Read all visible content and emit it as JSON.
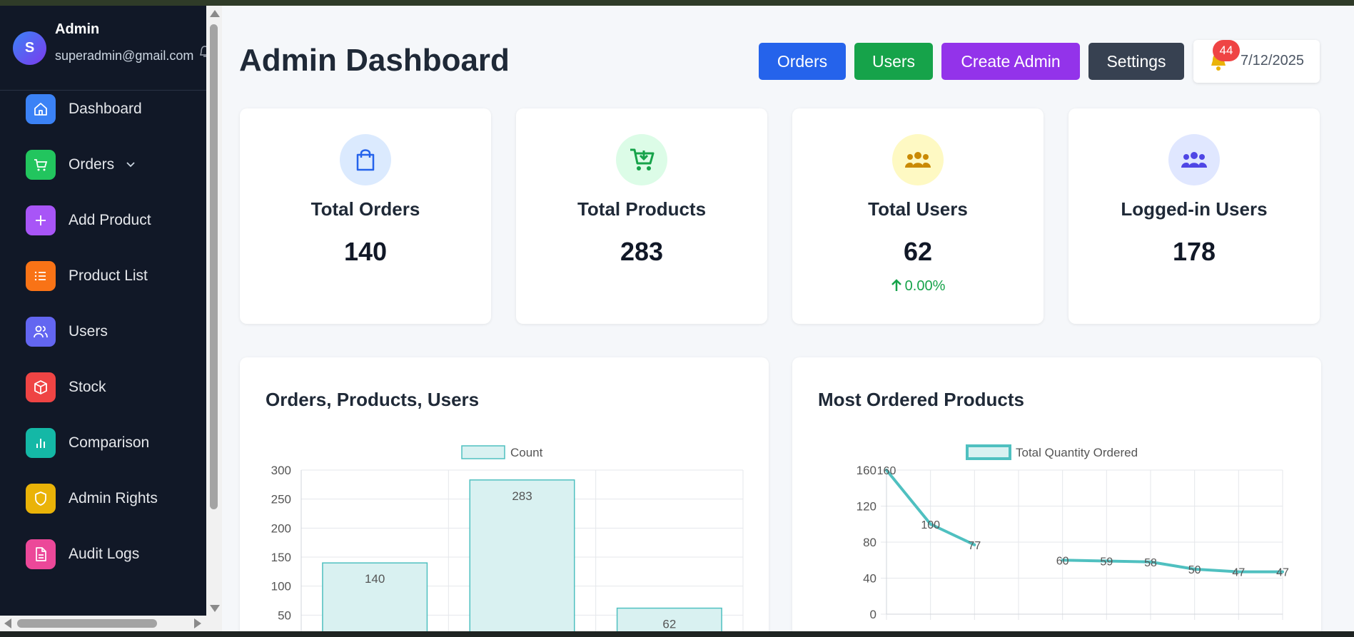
{
  "sidebar": {
    "profile": {
      "initial": "S",
      "name": "Admin",
      "email": "superadmin@gmail.com"
    },
    "items": [
      {
        "label": "Dashboard",
        "icon": "home-icon",
        "color": "#3b82f6"
      },
      {
        "label": "Orders",
        "icon": "cart-icon",
        "color": "#22c55e"
      },
      {
        "label": "Add Product",
        "icon": "plus-icon",
        "color": "#a855f7"
      },
      {
        "label": "Product List",
        "icon": "list-icon",
        "color": "#f97316"
      },
      {
        "label": "Users",
        "icon": "users-icon",
        "color": "#6366f1"
      },
      {
        "label": "Stock",
        "icon": "box-icon",
        "color": "#ef4444"
      },
      {
        "label": "Comparison",
        "icon": "bar-chart-icon",
        "color": "#14b8a6"
      },
      {
        "label": "Admin Rights",
        "icon": "shield-icon",
        "color": "#eab308"
      },
      {
        "label": "Audit Logs",
        "icon": "document-icon",
        "color": "#ec4899"
      }
    ]
  },
  "header": {
    "title": "Admin Dashboard",
    "buttons": [
      {
        "label": "Orders",
        "color": "#2563eb"
      },
      {
        "label": "Users",
        "color": "#16a34a"
      },
      {
        "label": "Create Admin",
        "color": "#9333ea"
      },
      {
        "label": "Settings",
        "color": "#374151"
      }
    ],
    "notification_count": "44",
    "date": "7/12/2025"
  },
  "stats": [
    {
      "title": "Total Orders",
      "value": "140",
      "icon": "shopping-bag-icon",
      "icon_bg": "#dbeafe",
      "icon_color": "#2563eb"
    },
    {
      "title": "Total Products",
      "value": "283",
      "icon": "cart-download-icon",
      "icon_bg": "#dcfce7",
      "icon_color": "#16a34a"
    },
    {
      "title": "Total Users",
      "value": "62",
      "trend": "0.00%",
      "icon": "users-group-icon",
      "icon_bg": "#fef9c3",
      "icon_color": "#ca8a04"
    },
    {
      "title": "Logged-in Users",
      "value": "178",
      "icon": "users-group-icon",
      "icon_bg": "#e0e7ff",
      "icon_color": "#4f46e5"
    }
  ],
  "charts": {
    "bar_title": "Orders, Products, Users",
    "line_title": "Most Ordered Products"
  },
  "chart_data": [
    {
      "type": "bar",
      "title": "Orders, Products, Users",
      "legend": [
        "Count"
      ],
      "legend_position": "top-center",
      "values": [
        140,
        283,
        62
      ],
      "ylim": [
        0,
        300
      ],
      "yticks": [
        50,
        100,
        150,
        200,
        250,
        300
      ],
      "grid": true,
      "color": "#4fc0c0"
    },
    {
      "type": "line",
      "title": "Most Ordered Products",
      "legend": [
        "Total Quantity Ordered"
      ],
      "legend_position": "top-center",
      "series": [
        {
          "name": "Total Quantity Ordered",
          "values": [
            160,
            100,
            77,
            null,
            60,
            59,
            58,
            50,
            47,
            47
          ]
        }
      ],
      "ylim": [
        0,
        160
      ],
      "yticks": [
        0,
        40,
        80,
        120,
        160
      ],
      "grid": true,
      "color": "#4fc0c0"
    }
  ]
}
